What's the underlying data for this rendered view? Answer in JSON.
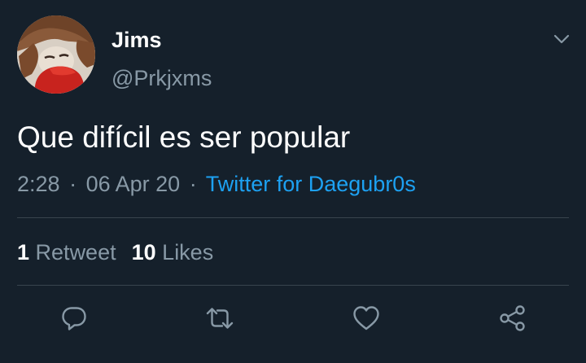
{
  "user": {
    "display_name": "Jims",
    "handle": "@Prkjxms"
  },
  "tweet": {
    "text": "Que difícil es ser popular",
    "time": "2:28",
    "date": "06 Apr 20",
    "separator": "·",
    "source": "Twitter for Daegubr0s"
  },
  "stats": {
    "retweets_count": "1",
    "retweets_label": "Retweet",
    "likes_count": "10",
    "likes_label": "Likes"
  },
  "icons": {
    "menu": "chevron-down-icon",
    "reply": "reply-icon",
    "retweet": "retweet-icon",
    "like": "heart-icon",
    "share": "share-icon"
  },
  "colors": {
    "background": "#15202b",
    "text_primary": "#ffffff",
    "text_secondary": "#8899a6",
    "link": "#1da1f2",
    "divider": "#38444d"
  }
}
